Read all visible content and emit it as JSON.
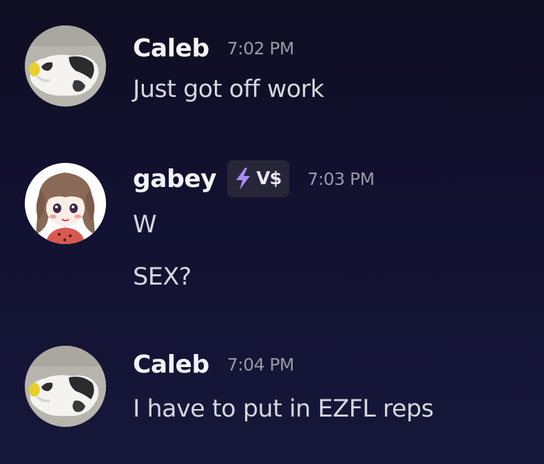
{
  "messages": [
    {
      "username": "Caleb",
      "timestamp": "7:02 PM",
      "avatar": "cat-avatar",
      "lines": [
        "Just got off work"
      ]
    },
    {
      "username": "gabey",
      "timestamp": "7:03 PM",
      "avatar": "anime-girl-avatar",
      "tag": {
        "icon": "lightning-icon",
        "label": "V$"
      },
      "lines": [
        "W",
        "SEX?"
      ]
    },
    {
      "username": "Caleb",
      "timestamp": "7:04 PM",
      "avatar": "cat-avatar",
      "lines": [
        "I have to put in EZFL reps"
      ]
    }
  ],
  "colors": {
    "background_top": "#0f0e22",
    "background_bottom": "#17173a",
    "username": "#f2f3f5",
    "timestamp": "#9a9aa6",
    "message_text": "#d6d6de",
    "tag_background": "#272638",
    "tag_icon": "#a98cf0"
  }
}
